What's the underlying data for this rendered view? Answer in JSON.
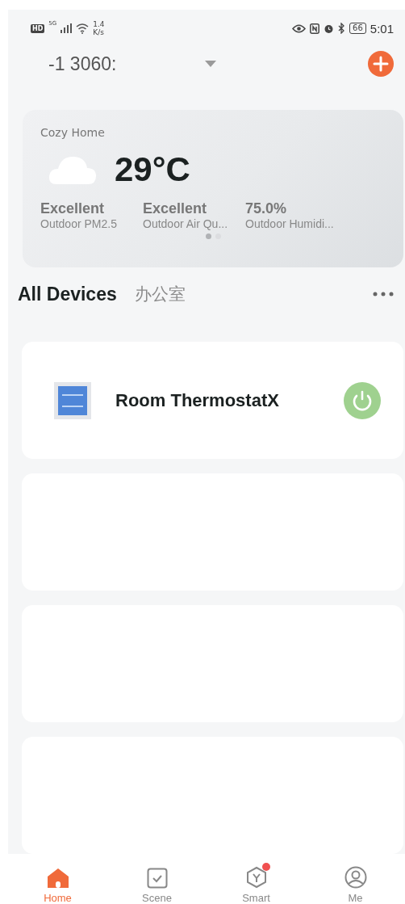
{
  "status_bar": {
    "hd": "HD",
    "network": "5G",
    "speed_value": "1.4",
    "speed_unit": "K/s",
    "battery": "66",
    "time": "5:01"
  },
  "header": {
    "home_name": "-1 3060:"
  },
  "weather": {
    "home": "Cozy Home",
    "temperature": "29°C",
    "stats": [
      {
        "value": "Excellent",
        "label": "Outdoor PM2.5"
      },
      {
        "value": "Excellent",
        "label": "Outdoor Air Qu..."
      },
      {
        "value": "75.0%",
        "label": "Outdoor Humidi..."
      }
    ],
    "pages": [
      {
        "selected": true
      },
      {
        "selected": false
      }
    ]
  },
  "tabs": [
    {
      "label": "All Devices",
      "selected": true
    },
    {
      "label": "办公室",
      "selected": false
    }
  ],
  "devices": [
    {
      "kind": "device",
      "name": "Room ThermostatX",
      "on": true
    },
    {
      "kind": "blank"
    },
    {
      "kind": "blank"
    },
    {
      "kind": "blank"
    }
  ],
  "nav": [
    {
      "label": "Home",
      "kind": "home",
      "selected": true,
      "badge": false
    },
    {
      "label": "Scene",
      "kind": "scene",
      "selected": false,
      "badge": false
    },
    {
      "label": "Smart",
      "kind": "smart",
      "selected": false,
      "badge": true
    },
    {
      "label": "Me",
      "kind": "me",
      "selected": false,
      "badge": false
    }
  ]
}
